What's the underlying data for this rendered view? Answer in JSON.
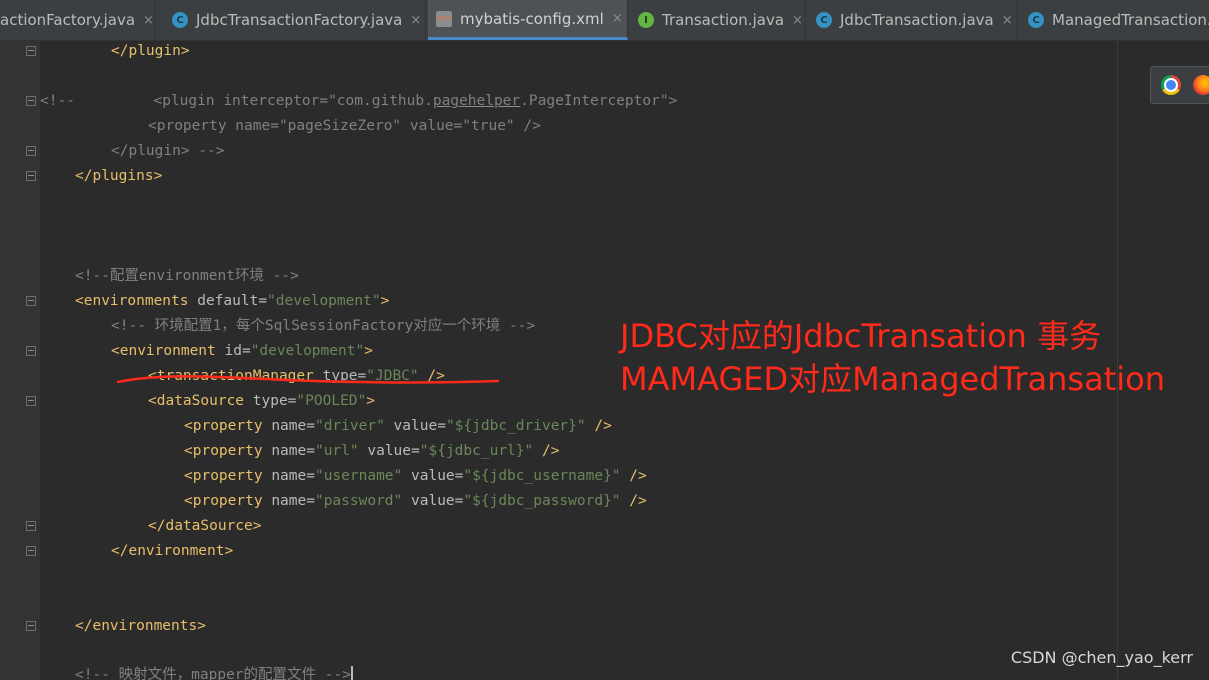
{
  "tabs": [
    {
      "label": "actionFactory.java",
      "icon": "none",
      "active": false
    },
    {
      "label": "JdbcTransactionFactory.java",
      "icon": "java-class-icon",
      "active": false
    },
    {
      "label": "mybatis-config.xml",
      "icon": "xml-file-icon",
      "active": true
    },
    {
      "label": "Transaction.java",
      "icon": "java-interface-icon",
      "active": false
    },
    {
      "label": "JdbcTransaction.java",
      "icon": "java-class-icon",
      "active": false
    },
    {
      "label": "ManagedTransaction.j",
      "icon": "java-class-icon",
      "active": false
    }
  ],
  "tab_close_glyph": "×",
  "icon_letters": {
    "class": "C",
    "interface": "I",
    "xml": "<>"
  },
  "code": {
    "plugin_close": "</plugin>",
    "c_plugin_open_a": "<!--         <plugin interceptor=\"com.github.",
    "c_plugin_open_u": "pagehelper",
    "c_plugin_open_b": ".PageInterceptor\">",
    "c_property": "<property name=\"pageSizeZero\" value=\"true\" />",
    "c_plugin_close": "</plugin> -->",
    "plugins_close": "</plugins>",
    "c_env_comment": "<!--配置environment环境 -->",
    "env_tag_open": "<environments",
    "env_attr_default": "default=",
    "env_val_default": "\"development\"",
    "env_tag_end": ">",
    "c_env_config": "<!-- 环境配置1，每个SqlSessionFactory对应一个环境 -->",
    "environment_tag_open": "<environment",
    "environment_attr_id": "id=",
    "environment_val_id": "\"development\"",
    "environment_tag_end": ">",
    "tm_tag_open": "<transactionManager",
    "tm_attr_type": "type=",
    "tm_val_type": "\"JDBC\"",
    "tm_tag_end": "/>",
    "ds_tag_open": "<dataSource",
    "ds_attr_type": "type=",
    "ds_val_type": "\"POOLED\"",
    "ds_tag_end": ">",
    "prop_tag": "<property",
    "prop_attr_name": "name=",
    "prop_attr_value": "value=",
    "prop_tag_end": "/>",
    "prop_driver_name": "\"driver\"",
    "prop_driver_value": "\"${jdbc_driver}\"",
    "prop_url_name": "\"url\"",
    "prop_url_value": "\"${jdbc_url}\"",
    "prop_username_name": "\"username\"",
    "prop_username_value": "\"${jdbc_username}\"",
    "prop_password_name": "\"password\"",
    "prop_password_value": "\"${jdbc_password}\"",
    "ds_close": "</dataSource>",
    "environment_close": "</environment>",
    "environments_close": "</environments>",
    "c_mapper": "<!-- 映射文件，mapper的配置文件 -->"
  },
  "annotations": {
    "line1": "JDBC对应的JdbcTransation 事务",
    "line2": "MAMAGED对应ManagedTransation"
  },
  "watermark": "CSDN @chen_yao_kerr",
  "colors": {
    "tag": "#e8bf6a",
    "attribute": "#bababa",
    "string_value": "#6a8759",
    "comment": "#808080",
    "annotation": "#ff2a1a",
    "active_tab_underline": "#4a88c7"
  }
}
